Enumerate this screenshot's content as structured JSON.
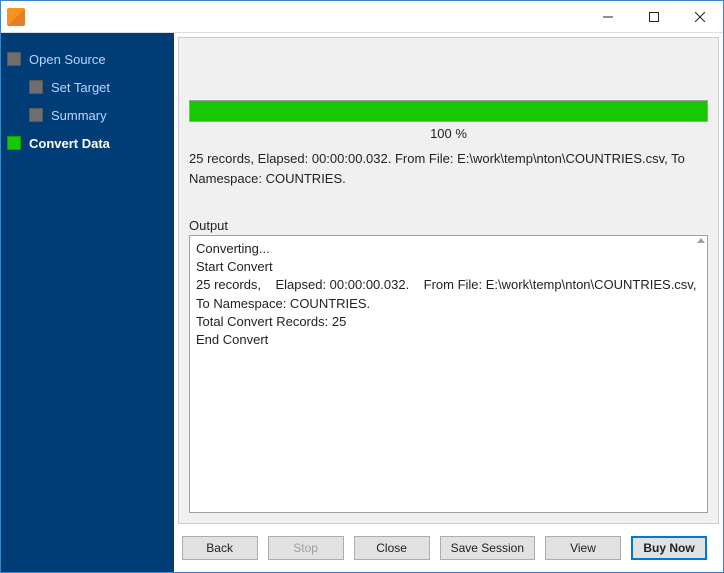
{
  "titlebar": {
    "title": ""
  },
  "sidebar": {
    "items": [
      {
        "label": "Open Source",
        "active": false,
        "indent": 0
      },
      {
        "label": "Set Target",
        "active": false,
        "indent": 1
      },
      {
        "label": "Summary",
        "active": false,
        "indent": 1
      },
      {
        "label": "Convert Data",
        "active": true,
        "indent": 0
      }
    ]
  },
  "progress": {
    "percent_value": 100,
    "percent_text": "100 %",
    "summary": "25 records,    Elapsed: 00:00:00.032.    From File: E:\\work\\temp\\nton\\COUNTRIES.csv,    To Namespace: COUNTRIES."
  },
  "output": {
    "label": "Output",
    "lines": [
      "Converting...",
      "Start Convert",
      "25 records,    Elapsed: 00:00:00.032.    From File: E:\\work\\temp\\nton\\COUNTRIES.csv,    To Namespace: COUNTRIES.",
      "Total Convert Records: 25",
      "End Convert"
    ]
  },
  "buttons": {
    "back": "Back",
    "stop": "Stop",
    "close": "Close",
    "save_session": "Save Session",
    "view": "View",
    "buy_now": "Buy Now"
  }
}
